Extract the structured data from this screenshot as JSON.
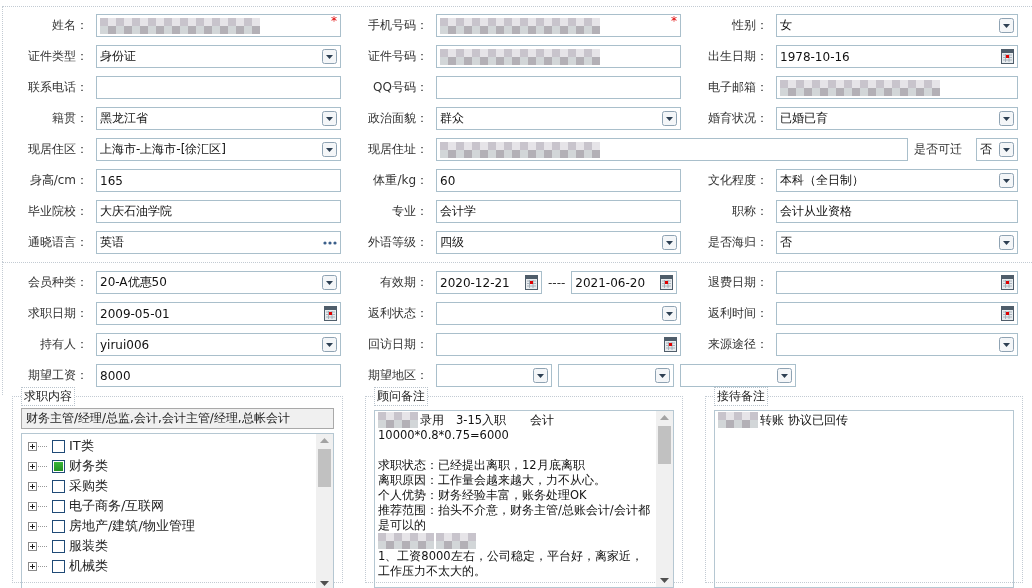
{
  "sections": [
    {
      "rows": [
        [
          {
            "label": "姓名：",
            "field": {
              "kind": "text",
              "redacted": true,
              "required_mark": "*"
            }
          },
          {
            "label": "手机号码：",
            "field": {
              "kind": "text",
              "redacted": true,
              "required_mark": "*"
            }
          },
          {
            "label": "性别：",
            "field": {
              "kind": "select",
              "value": "女"
            }
          }
        ],
        [
          {
            "label": "证件类型：",
            "field": {
              "kind": "select",
              "value": "身份证"
            }
          },
          {
            "label": "证件号码：",
            "field": {
              "kind": "text",
              "redacted": true
            }
          },
          {
            "label": "出生日期：",
            "field": {
              "kind": "date",
              "value": "1978-10-16"
            }
          }
        ],
        [
          {
            "label": "联系电话：",
            "field": {
              "kind": "text"
            }
          },
          {
            "label": "QQ号码：",
            "field": {
              "kind": "text"
            }
          },
          {
            "label": "电子邮箱：",
            "field": {
              "kind": "text",
              "redacted": true
            }
          }
        ],
        [
          {
            "label": "籍贯：",
            "field": {
              "kind": "select",
              "value": "黑龙江省"
            }
          },
          {
            "label": "政治面貌：",
            "field": {
              "kind": "select",
              "value": "群众"
            }
          },
          {
            "label": "婚育状况：",
            "field": {
              "kind": "select",
              "value": "已婚已育"
            }
          }
        ],
        [
          {
            "label": "现居住区：",
            "field": {
              "kind": "select",
              "value": "上海市-上海市-[徐汇区]"
            }
          },
          {
            "label": "现居住址：",
            "field": {
              "kind": "text",
              "redacted": true
            },
            "extra": {
              "label": "是否可迁",
              "field": {
                "kind": "select",
                "value": "否"
              }
            }
          }
        ],
        [
          {
            "label": "身高/cm：",
            "field": {
              "kind": "text",
              "value": "165"
            }
          },
          {
            "label": "体重/kg：",
            "field": {
              "kind": "text",
              "value": "60"
            }
          },
          {
            "label": "文化程度：",
            "field": {
              "kind": "select",
              "value": "本科（全日制）"
            }
          }
        ],
        [
          {
            "label": "毕业院校：",
            "field": {
              "kind": "text",
              "value": "大庆石油学院"
            }
          },
          {
            "label": "专业：",
            "field": {
              "kind": "text",
              "value": "会计学"
            }
          },
          {
            "label": "职称：",
            "field": {
              "kind": "text",
              "value": "会计从业资格"
            }
          }
        ],
        [
          {
            "label": "通晓语言：",
            "field": {
              "kind": "lookup",
              "value": "英语"
            }
          },
          {
            "label": "外语等级：",
            "field": {
              "kind": "select",
              "value": "四级"
            }
          },
          {
            "label": "是否海归：",
            "field": {
              "kind": "select",
              "value": "否"
            }
          }
        ]
      ]
    },
    {
      "rows": [
        [
          {
            "label": "会员种类：",
            "field": {
              "kind": "select",
              "value": "20-A优惠50"
            }
          },
          {
            "label": "有效期：",
            "fields": [
              {
                "kind": "date",
                "value": "2020-12-21"
              },
              {
                "kind": "date",
                "value": "2021-06-20"
              }
            ],
            "separator": "----"
          },
          {
            "label": "退费日期：",
            "field": {
              "kind": "date"
            }
          }
        ],
        [
          {
            "label": "求职日期：",
            "field": {
              "kind": "date",
              "value": "2009-05-01"
            }
          },
          {
            "label": "返利状态：",
            "field": {
              "kind": "select"
            }
          },
          {
            "label": "返利时间：",
            "field": {
              "kind": "date"
            }
          }
        ],
        [
          {
            "label": "持有人：",
            "field": {
              "kind": "select",
              "value": "yirui006"
            }
          },
          {
            "label": "回访日期：",
            "field": {
              "kind": "date"
            }
          },
          {
            "label": "来源途径：",
            "field": {
              "kind": "select"
            }
          }
        ],
        [
          {
            "label": "期望工资：",
            "field": {
              "kind": "text",
              "value": "8000"
            }
          },
          {
            "label": "期望地区：",
            "fields": [
              {
                "kind": "select"
              },
              {
                "kind": "select"
              },
              {
                "kind": "select"
              }
            ]
          }
        ]
      ]
    }
  ],
  "job_content": {
    "legend": "求职内容",
    "summary": "财务主管/经理/总监,会计,会计主管/经理,总帐会计",
    "tree": [
      {
        "label": "IT类",
        "checked": false,
        "expanded": false
      },
      {
        "label": "财务类",
        "checked": true,
        "expanded": false
      },
      {
        "label": "采购类",
        "checked": false,
        "expanded": false
      },
      {
        "label": "电子商务/互联网",
        "checked": false,
        "expanded": false
      },
      {
        "label": "房地产/建筑/物业管理",
        "checked": false,
        "expanded": false
      },
      {
        "label": "服装类",
        "checked": false,
        "expanded": false
      },
      {
        "label": "机械类",
        "checked": false,
        "expanded": false
      }
    ]
  },
  "notes": [
    {
      "legend": "顾问备注",
      "scrollbar": true,
      "lines": [
        {
          "kind": "text",
          "redacted": true,
          "text": "录用　3-15入职　　会计"
        },
        {
          "kind": "text",
          "text": "10000*0.8*0.75=6000"
        },
        {
          "kind": "blank"
        },
        {
          "kind": "text",
          "text": "求职状态：已经提出离职，12月底离职"
        },
        {
          "kind": "text",
          "text": "离职原因：工作量会越来越大，力不从心。"
        },
        {
          "kind": "text",
          "text": "个人优势：财务经验丰富，账务处理OK"
        },
        {
          "kind": "text",
          "text": "推荐范围：抬头不介意，财务主管/总账会计/会计都是可以的"
        },
        {
          "kind": "redacted"
        },
        {
          "kind": "text",
          "text": "1、工资8000左右，公司稳定，平台好，离家近，工作压力不太大的。"
        }
      ]
    },
    {
      "legend": "接待备注",
      "scrollbar": false,
      "lines": [
        {
          "kind": "text",
          "redacted": true,
          "text": "转账 协议已回传"
        }
      ]
    }
  ]
}
